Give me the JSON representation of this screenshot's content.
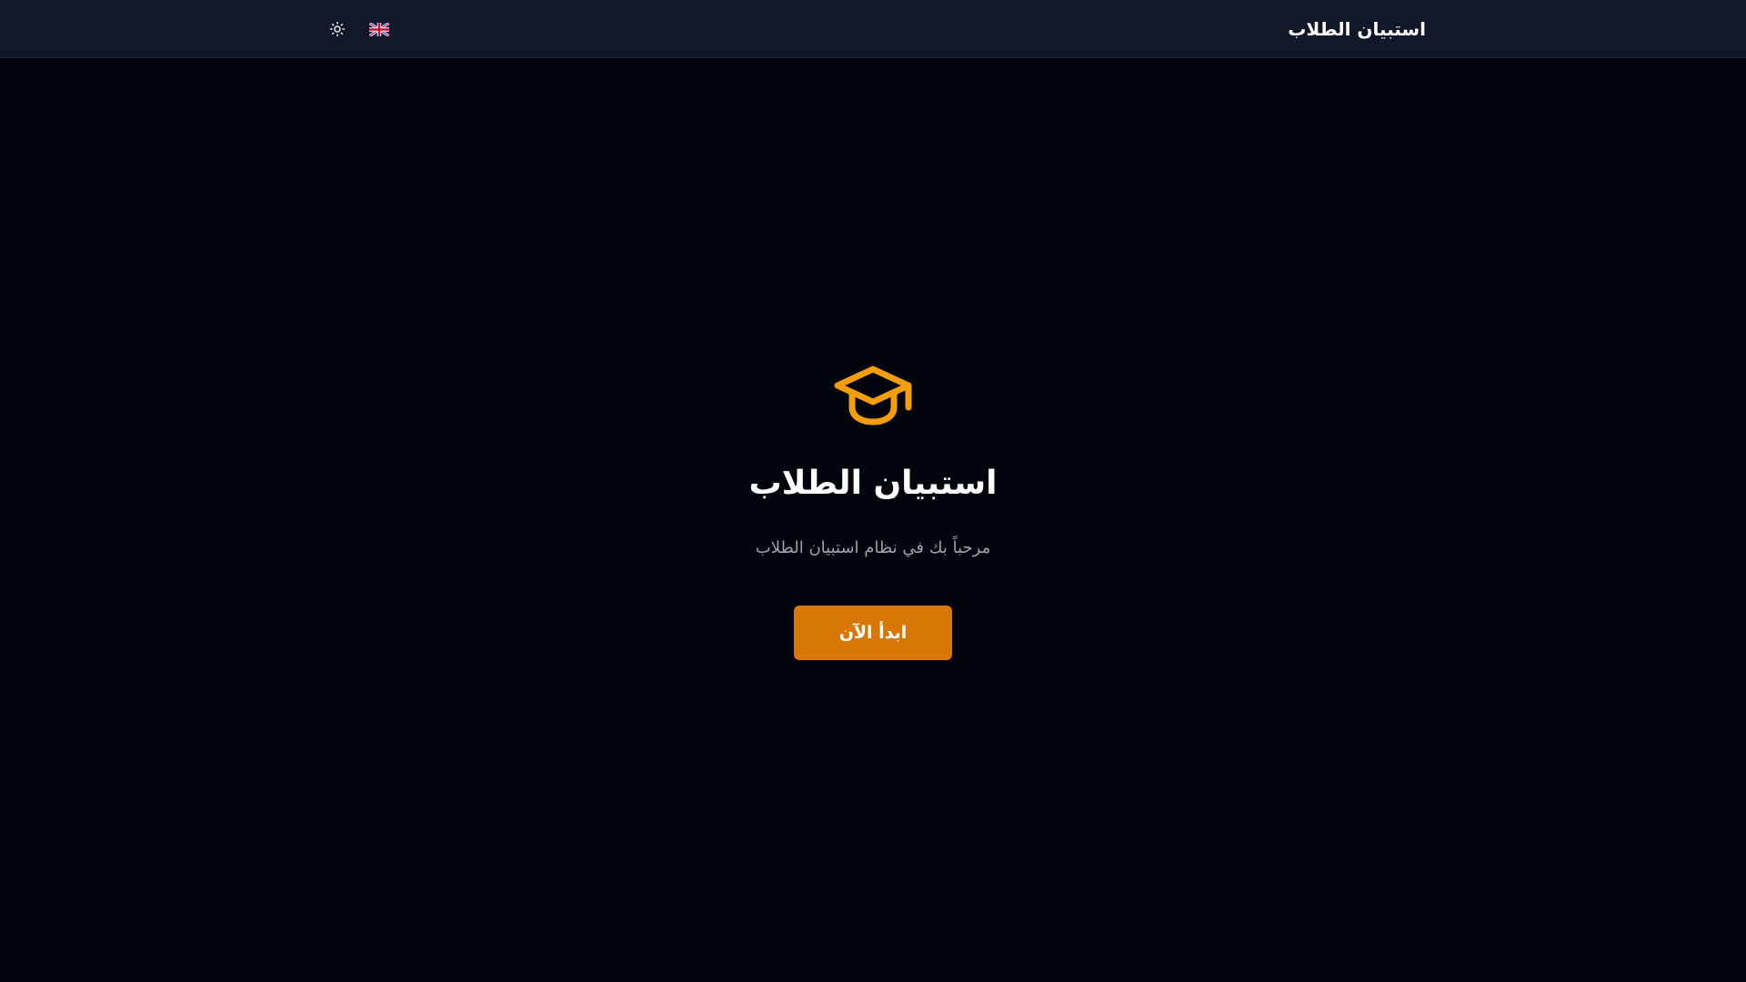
{
  "header": {
    "title": "استبيان الطلاب",
    "theme_icon": "sun-icon",
    "language_icon": "uk-flag-icon"
  },
  "hero": {
    "icon": "graduation-cap-icon",
    "title": "استبيان الطلاب",
    "subtitle": "مرحباً بك في نظام استبيان الطلاب",
    "cta_label": "ابدأ الآن"
  },
  "colors": {
    "background": "#02050d",
    "header_background": "#111827",
    "accent": "#f59e0b",
    "button": "#d97706",
    "subtitle": "#9ca3af"
  }
}
